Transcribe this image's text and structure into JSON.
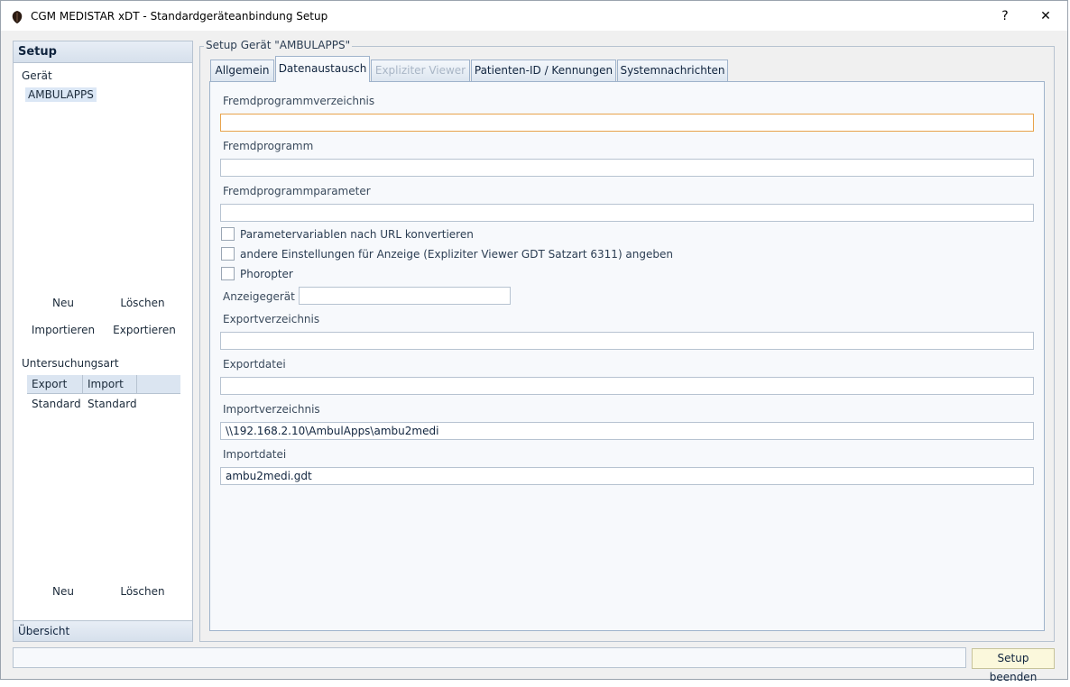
{
  "window": {
    "title": "CGM MEDISTAR xDT - Standardgeräteanbindung  Setup",
    "help_label": "?",
    "close_label": "✕"
  },
  "left_panel": {
    "header": "Setup",
    "section_device": "Gerät",
    "devices": [
      "AMBULAPPS"
    ],
    "btn_new": "Neu",
    "btn_delete": "Löschen",
    "btn_import": "Importieren",
    "btn_export": "Exportieren",
    "section_exam": "Untersuchungsart",
    "exam_columns": [
      "Export",
      "Import"
    ],
    "exam_rows": [
      [
        "Standard",
        "Standard"
      ]
    ],
    "btn_new2": "Neu",
    "btn_delete2": "Löschen",
    "footer": "Übersicht"
  },
  "group": {
    "legend": "Setup Gerät \"AMBULAPPS\"",
    "tabs": [
      "Allgemein",
      "Datenaustausch",
      "Expliziter Viewer",
      "Patienten-ID / Kennungen",
      "Systemnachrichten"
    ],
    "active_tab": "Datenaustausch"
  },
  "form": {
    "fremdprogrammverzeichnis_label": "Fremdprogrammverzeichnis",
    "fremdprogrammverzeichnis_value": "",
    "fremdprogramm_label": "Fremdprogramm",
    "fremdprogramm_value": "",
    "fremdprogrammparameter_label": "Fremdprogrammparameter",
    "fremdprogrammparameter_value": "",
    "chk_url_label": "Parametervariablen nach URL konvertieren",
    "chk_url_checked": false,
    "chk_anzeige_label": "andere Einstellungen für Anzeige (Expliziter Viewer GDT Satzart 6311) angeben",
    "chk_anzeige_checked": false,
    "chk_phoropter_label": "Phoropter",
    "chk_phoropter_checked": false,
    "anzeigegeraet_label": "Anzeigegerät",
    "anzeigegeraet_value": "",
    "exportverzeichnis_label": "Exportverzeichnis",
    "exportverzeichnis_value": "",
    "exportdatei_label": "Exportdatei",
    "exportdatei_value": "",
    "importverzeichnis_label": "Importverzeichnis",
    "importverzeichnis_value": "\\\\192.168.2.10\\AmbulApps\\ambu2medi",
    "importdatei_label": "Importdatei",
    "importdatei_value": "ambu2medi.gdt"
  },
  "footer": {
    "status_text": "",
    "end_button": "Setup beenden"
  },
  "colors": {
    "accent_border": "#b7c3d1",
    "focus_border": "#e8a34c",
    "selection": "#dbe7f5",
    "end_button_bg": "#fbf8dc"
  }
}
